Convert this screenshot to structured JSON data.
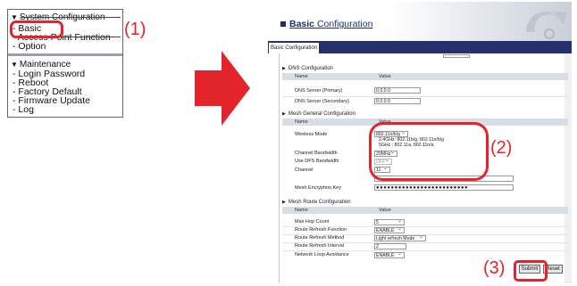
{
  "left_menu": {
    "system_header": "System Configuration",
    "system_items": [
      "Basic",
      "Access Point Function",
      "Option"
    ],
    "maintenance_header": "Maintenance",
    "maintenance_items": [
      "Login Password",
      "Reboot",
      "Factory Default",
      "Firmware Update",
      "Log"
    ]
  },
  "callouts": {
    "one": "(1)",
    "two": "(2)",
    "three": "(3)"
  },
  "window": {
    "title_prefix": "Basic",
    "title_rest": " Configuration",
    "tab_label": "Basic Configuration",
    "dns": {
      "title": "DNS Configuration",
      "col_name": "Name",
      "col_value": "Value",
      "rows": [
        {
          "label": "DNS Server (Primary)",
          "value": "0.0.0.0"
        },
        {
          "label": "DNS Server (Secondary)",
          "value": "0.0.0.0"
        }
      ]
    },
    "mesh_general": {
      "title": "Mesh General Configuration",
      "col_name": "Name",
      "col_value": "Value",
      "wireless_mode_label": "Wireless Mode",
      "wireless_mode_value": "802.11n/b/g",
      "wireless_note_1": "2.4GHz: 802.11b/g, 802.11n/b/g",
      "wireless_note_2": "5GHz : 802.11a, 802.11n/a",
      "channel_bandwidth_label": "Channel Bandwidth",
      "channel_bandwidth_value": "20MHz",
      "dfs_label": "Use DFS Bandwidth",
      "dfs_value": "OFF",
      "channel_label": "Channel",
      "channel_value": "11",
      "mesh_key_label": "Mesh Encryption Key",
      "mesh_key_value": "●●●●●●●●●●●●●●●●●●●●●●●●●"
    },
    "mesh_route": {
      "title": "Mesh Route Configuration",
      "col_name": "Name",
      "col_value": "Value",
      "rows": [
        {
          "label": "Max Hop Count",
          "value": "5"
        },
        {
          "label": "Route Refresh Function",
          "value": "ENABLE"
        },
        {
          "label": "Route Refresh Method",
          "value": "Light refresh Mode"
        },
        {
          "label": "Route Refresh Interval",
          "value": "2"
        },
        {
          "label": "Network Loop Avoidance",
          "value": "ENABLE"
        }
      ]
    },
    "submit_label": "Submit",
    "reset_label": "Reset"
  },
  "colors": {
    "callout": "#e3242b",
    "title": "#1e2f6e",
    "tabstrip": "#27306e"
  }
}
